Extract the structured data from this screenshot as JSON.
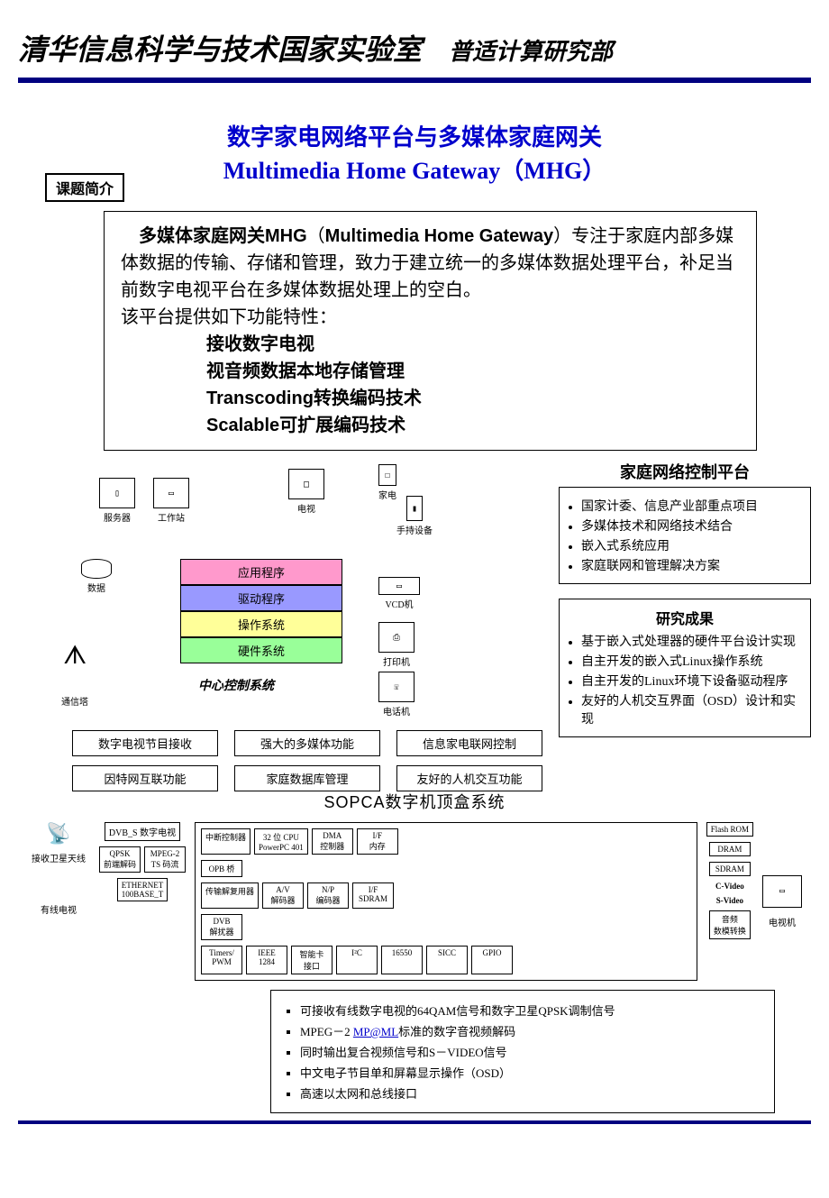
{
  "header": {
    "title": "清华信息科学与技术国家实验室",
    "subtitle": "普适计算研究部"
  },
  "main_title": {
    "cn": "数字家电网络平台与多媒体家庭网关",
    "en": "Multimedia Home Gateway（MHG）"
  },
  "section_label": "课题简介",
  "intro": {
    "p1a": "多媒体家庭网关MHG",
    "p1b": "（Multimedia Home Gateway）",
    "p1c": "专注于家庭内部多媒体数据的传输、存储和管理，致力于建立统一的多媒体数据处理平台，补足当前数字电视平台在多媒体数据处理上的空白。",
    "p2": "该平台提供如下功能特性：",
    "features": [
      "接收数字电视",
      "视音频数据本地存储管理",
      "Transcoding转换编码技术",
      "Scalable可扩展编码技术"
    ]
  },
  "home_net": {
    "title": "家庭网络控制平台",
    "bullets": [
      "国家计委、信息产业部重点项目",
      "多媒体技术和网络技术结合",
      "嵌入式系统应用",
      "家庭联网和管理解决方案"
    ]
  },
  "research": {
    "title": "研究成果",
    "bullets": [
      "基于嵌入式处理器的硬件平台设计实现",
      "自主开发的嵌入式Linux操作系统",
      "自主开发的Linux环境下设备驱动程序",
      "友好的人机交互界面（OSD）设计和实现"
    ]
  },
  "devices": {
    "server": "服务器",
    "workstation": "工作站",
    "db": "数据",
    "tv": "电视",
    "appliance": "家电",
    "handheld": "手持设备",
    "vcd": "VCD机",
    "printer": "打印机",
    "phone": "电话机",
    "tower": "通信塔"
  },
  "stack": {
    "app": "应用程序",
    "drv": "驱动程序",
    "os": "操作系统",
    "hw": "硬件系统"
  },
  "center_label": "中心控制系统",
  "feature_boxes": {
    "row1": [
      "数字电视节目接收",
      "强大的多媒体功能",
      "信息家电联网控制"
    ],
    "row2": [
      "因特网互联功能",
      "家庭数据库管理",
      "友好的人机交互功能"
    ]
  },
  "sopca": {
    "title": "SOPCA数字机顶盒系统",
    "left_labels": {
      "dish": "接收卫星天线",
      "cable": "有线电视",
      "dvbs": "DVB_S 数字电视",
      "qpsk": "QPSK\n前端解码",
      "mpeg2": "MPEG-2\nTS 码流",
      "eth": "ETHERNET\n100BASE_T"
    },
    "core": {
      "intc": "中断控制器",
      "cpu": "32 位 CPU\nPowerPC 401",
      "dma": "DMA\n控制器",
      "if_mem": "I/F\n内存",
      "opb": "OPB 桥",
      "demux": "传输解复用器",
      "av": "A/V\n解码器",
      "np": "N/P\n编码器",
      "if_sdram": "I/F\nSDRAM",
      "dvb": "DVB\n解扰器",
      "bus": [
        "Timers/\nPWM",
        "IEEE\n1284",
        "智能卡\n接口",
        "I²C",
        "16550",
        "SICC",
        "GPIO"
      ]
    },
    "right": {
      "flash": "Flash ROM",
      "dram": "DRAM",
      "sdram": "SDRAM",
      "cvideo": "C-Video",
      "svideo": "S-Video",
      "dac": "音频\n数模转换",
      "tv": "电视机"
    }
  },
  "bottom_features": [
    "可接收有线数字电视的64QAM信号和数字卫星QPSK调制信号",
    "MPEG－2 MP@ML标准的数字音视频解码",
    "同时输出复合视频信号和S－VIDEO信号",
    "中文电子节目单和屏幕显示操作（OSD）",
    "高速以太网和总线接口"
  ]
}
